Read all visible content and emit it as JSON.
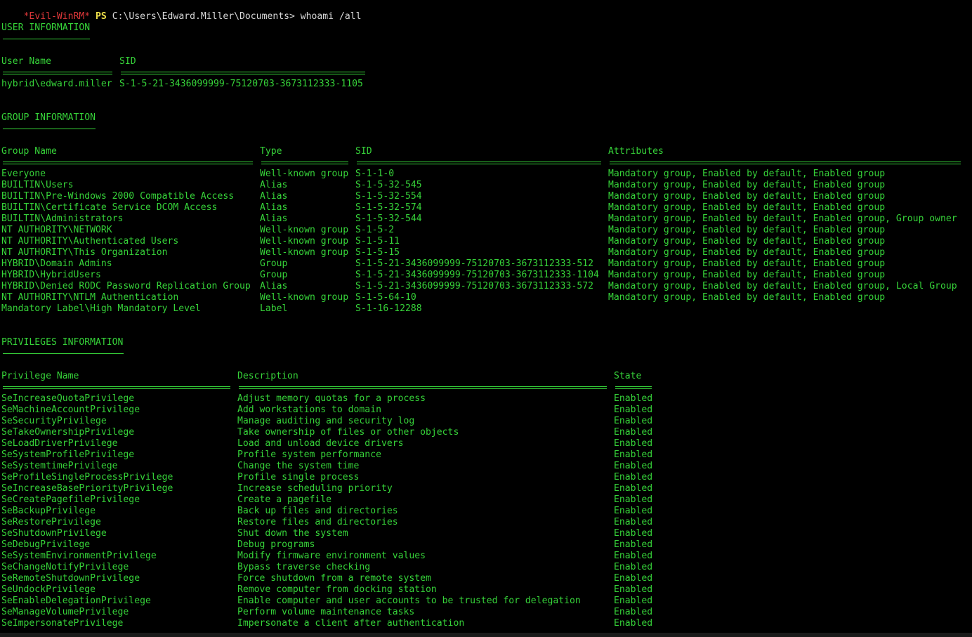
{
  "prompt": {
    "session": "*Evil-WinRM*",
    "shell": "PS",
    "path": "C:\\Users\\Edward.Miller\\Documents>",
    "command": "whoami /all"
  },
  "user_info": {
    "heading": "USER INFORMATION",
    "col_user": "User Name",
    "col_sid": "SID",
    "user_name": "hybrid\\edward.miller",
    "user_sid": "S-1-5-21-3436099999-75120703-3673112333-1105"
  },
  "group_info": {
    "heading": "GROUP INFORMATION",
    "columns": [
      "Group Name",
      "Type",
      "SID",
      "Attributes"
    ],
    "rows": [
      [
        "Everyone",
        "Well-known group",
        "S-1-1-0",
        "Mandatory group, Enabled by default, Enabled group"
      ],
      [
        "BUILTIN\\Users",
        "Alias",
        "S-1-5-32-545",
        "Mandatory group, Enabled by default, Enabled group"
      ],
      [
        "BUILTIN\\Pre-Windows 2000 Compatible Access",
        "Alias",
        "S-1-5-32-554",
        "Mandatory group, Enabled by default, Enabled group"
      ],
      [
        "BUILTIN\\Certificate Service DCOM Access",
        "Alias",
        "S-1-5-32-574",
        "Mandatory group, Enabled by default, Enabled group"
      ],
      [
        "BUILTIN\\Administrators",
        "Alias",
        "S-1-5-32-544",
        "Mandatory group, Enabled by default, Enabled group, Group owner"
      ],
      [
        "NT AUTHORITY\\NETWORK",
        "Well-known group",
        "S-1-5-2",
        "Mandatory group, Enabled by default, Enabled group"
      ],
      [
        "NT AUTHORITY\\Authenticated Users",
        "Well-known group",
        "S-1-5-11",
        "Mandatory group, Enabled by default, Enabled group"
      ],
      [
        "NT AUTHORITY\\This Organization",
        "Well-known group",
        "S-1-5-15",
        "Mandatory group, Enabled by default, Enabled group"
      ],
      [
        "HYBRID\\Domain Admins",
        "Group",
        "S-1-5-21-3436099999-75120703-3673112333-512",
        "Mandatory group, Enabled by default, Enabled group"
      ],
      [
        "HYBRID\\HybridUsers",
        "Group",
        "S-1-5-21-3436099999-75120703-3673112333-1104",
        "Mandatory group, Enabled by default, Enabled group"
      ],
      [
        "HYBRID\\Denied RODC Password Replication Group",
        "Alias",
        "S-1-5-21-3436099999-75120703-3673112333-572",
        "Mandatory group, Enabled by default, Enabled group, Local Group"
      ],
      [
        "NT AUTHORITY\\NTLM Authentication",
        "Well-known group",
        "S-1-5-64-10",
        "Mandatory group, Enabled by default, Enabled group"
      ],
      [
        "Mandatory Label\\High Mandatory Level",
        "Label",
        "S-1-16-12288",
        ""
      ]
    ]
  },
  "privileges_info": {
    "heading": "PRIVILEGES INFORMATION",
    "columns": [
      "Privilege Name",
      "Description",
      "State"
    ],
    "rows": [
      [
        "SeIncreaseQuotaPrivilege",
        "Adjust memory quotas for a process",
        "Enabled"
      ],
      [
        "SeMachineAccountPrivilege",
        "Add workstations to domain",
        "Enabled"
      ],
      [
        "SeSecurityPrivilege",
        "Manage auditing and security log",
        "Enabled"
      ],
      [
        "SeTakeOwnershipPrivilege",
        "Take ownership of files or other objects",
        "Enabled"
      ],
      [
        "SeLoadDriverPrivilege",
        "Load and unload device drivers",
        "Enabled"
      ],
      [
        "SeSystemProfilePrivilege",
        "Profile system performance",
        "Enabled"
      ],
      [
        "SeSystemtimePrivilege",
        "Change the system time",
        "Enabled"
      ],
      [
        "SeProfileSingleProcessPrivilege",
        "Profile single process",
        "Enabled"
      ],
      [
        "SeIncreaseBasePriorityPrivilege",
        "Increase scheduling priority",
        "Enabled"
      ],
      [
        "SeCreatePagefilePrivilege",
        "Create a pagefile",
        "Enabled"
      ],
      [
        "SeBackupPrivilege",
        "Back up files and directories",
        "Enabled"
      ],
      [
        "SeRestorePrivilege",
        "Restore files and directories",
        "Enabled"
      ],
      [
        "SeShutdownPrivilege",
        "Shut down the system",
        "Enabled"
      ],
      [
        "SeDebugPrivilege",
        "Debug programs",
        "Enabled"
      ],
      [
        "SeSystemEnvironmentPrivilege",
        "Modify firmware environment values",
        "Enabled"
      ],
      [
        "SeChangeNotifyPrivilege",
        "Bypass traverse checking",
        "Enabled"
      ],
      [
        "SeRemoteShutdownPrivilege",
        "Force shutdown from a remote system",
        "Enabled"
      ],
      [
        "SeUndockPrivilege",
        "Remove computer from docking station",
        "Enabled"
      ],
      [
        "SeEnableDelegationPrivilege",
        "Enable computer and user accounts to be trusted for delegation",
        "Enabled"
      ],
      [
        "SeManageVolumePrivilege",
        "Perform volume maintenance tasks",
        "Enabled"
      ],
      [
        "SeImpersonatePrivilege",
        "Impersonate a client after authentication",
        "Enabled"
      ]
    ]
  }
}
